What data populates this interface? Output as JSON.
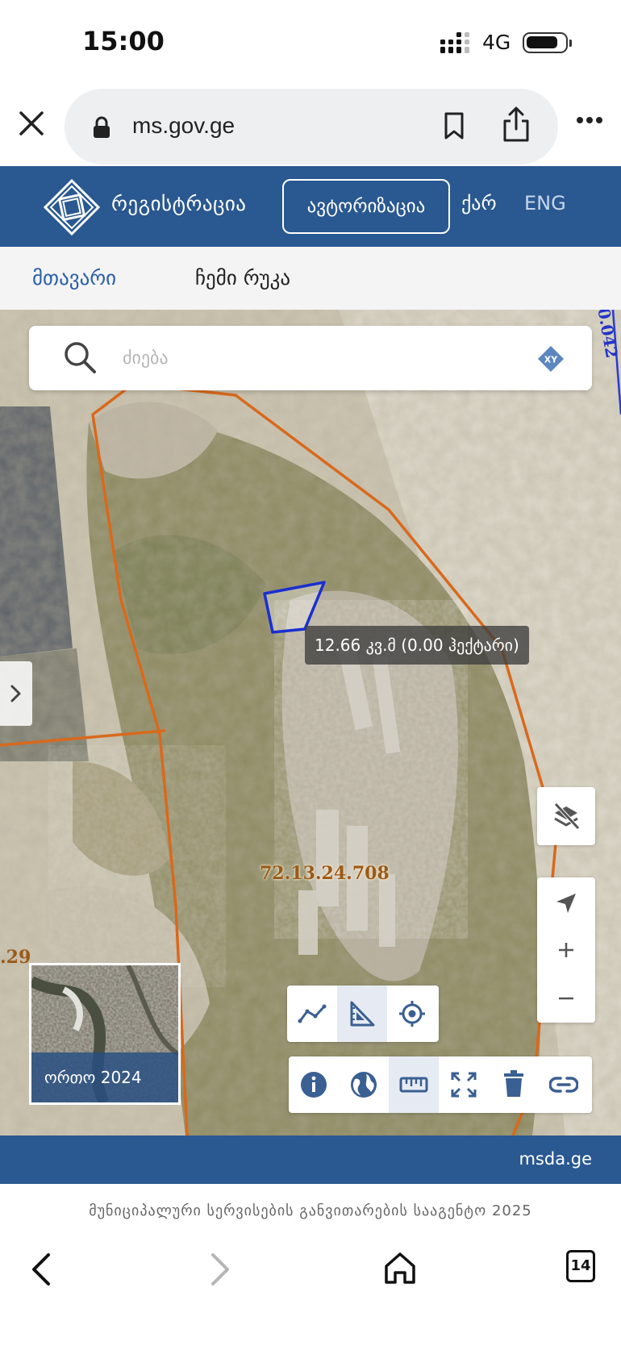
{
  "status_bar": {
    "time": "15:00",
    "network": "4G"
  },
  "browser": {
    "url": "ms.gov.ge"
  },
  "header": {
    "logo_text": "რეგისტრაცია",
    "auth_label": "ავტორიზაცია",
    "lang_ka": "ქარ",
    "lang_en": "ENG"
  },
  "tabs": {
    "main": "მთავარი",
    "my_map": "ჩემი რუკა"
  },
  "search": {
    "placeholder": "ძიება",
    "xy_label": "XY"
  },
  "map": {
    "measurement": "12.66 კვ.მ (0.00 ჰექტარი)",
    "parcel_code": "72.13.24.708",
    "edge_left": ".29",
    "edge_right": "0.042",
    "basemap_label": "ორთო 2024"
  },
  "colors": {
    "brand": "#2a5890",
    "parcel_line": "#d9691c",
    "measure_polygon": "#1a2fd0"
  },
  "footer": {
    "link": "msda.ge",
    "copyright": "მუნიციპალური სერვისების განვითარების სააგენტო 2025"
  },
  "bottom_nav": {
    "tab_count": "14"
  }
}
